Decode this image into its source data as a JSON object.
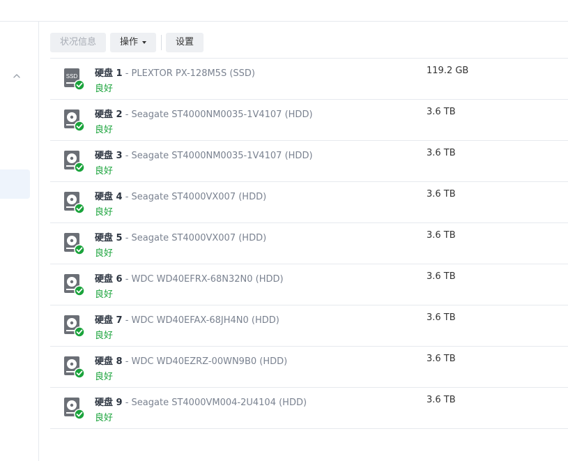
{
  "toolbar": {
    "status_info": "状况信息",
    "action": "操作",
    "settings": "设置"
  },
  "disks": [
    {
      "name": "硬盘 1",
      "model": "PLEXTOR PX-128M5S (SSD)",
      "status": "良好",
      "size": "119.2 GB",
      "kind": "ssd",
      "icon_label": "SSD"
    },
    {
      "name": "硬盘 2",
      "model": "Seagate ST4000NM0035-1V4107 (HDD)",
      "status": "良好",
      "size": "3.6 TB",
      "kind": "hdd"
    },
    {
      "name": "硬盘 3",
      "model": "Seagate ST4000NM0035-1V4107 (HDD)",
      "status": "良好",
      "size": "3.6 TB",
      "kind": "hdd"
    },
    {
      "name": "硬盘 4",
      "model": "Seagate ST4000VX007 (HDD)",
      "status": "良好",
      "size": "3.6 TB",
      "kind": "hdd"
    },
    {
      "name": "硬盘 5",
      "model": "Seagate ST4000VX007 (HDD)",
      "status": "良好",
      "size": "3.6 TB",
      "kind": "hdd"
    },
    {
      "name": "硬盘 6",
      "model": "WDC WD40EFRX-68N32N0 (HDD)",
      "status": "良好",
      "size": "3.6 TB",
      "kind": "hdd"
    },
    {
      "name": "硬盘 7",
      "model": "WDC WD40EFAX-68JH4N0 (HDD)",
      "status": "良好",
      "size": "3.6 TB",
      "kind": "hdd"
    },
    {
      "name": "硬盘 8",
      "model": "WDC WD40EZRZ-00WN9B0 (HDD)",
      "status": "良好",
      "size": "3.6 TB",
      "kind": "hdd"
    },
    {
      "name": "硬盘 9",
      "model": "Seagate ST4000VM004-2U4104 (HDD)",
      "status": "良好",
      "size": "3.6 TB",
      "kind": "hdd"
    }
  ],
  "colors": {
    "status_good": "#1aa33b",
    "disk_icon": "#6b6f76"
  },
  "icons": {
    "ssd": "ssd-drive-icon",
    "hdd": "hdd-drive-icon",
    "status": "check-circle-icon",
    "collapse": "chevron-up-icon",
    "menu_caret": "caret-down-icon"
  }
}
